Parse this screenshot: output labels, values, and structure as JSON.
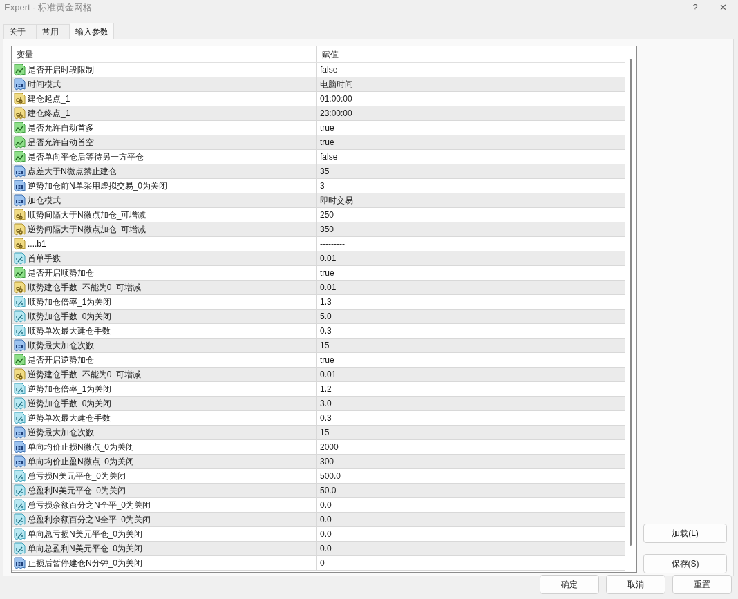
{
  "window": {
    "title": "Expert - 标准黄金网格",
    "help": "?",
    "close": "✕"
  },
  "tabs": [
    {
      "label": "关于",
      "selected": false
    },
    {
      "label": "常用",
      "selected": false
    },
    {
      "label": "输入参数",
      "selected": true
    }
  ],
  "table": {
    "columns": [
      "变量",
      "赋值"
    ],
    "rows": [
      {
        "kind": "bool",
        "name": "是否开启时段限制",
        "value": "false"
      },
      {
        "kind": "int",
        "name": "时间模式",
        "value": "电脑时间"
      },
      {
        "kind": "string",
        "name": "建仓起点_1",
        "value": "01:00:00"
      },
      {
        "kind": "string",
        "name": "建仓终点_1",
        "value": "23:00:00"
      },
      {
        "kind": "bool",
        "name": "是否允许自动首多",
        "value": "true"
      },
      {
        "kind": "bool",
        "name": "是否允许自动首空",
        "value": "true"
      },
      {
        "kind": "bool",
        "name": "是否单向平仓后等待另一方平仓",
        "value": "false"
      },
      {
        "kind": "int",
        "name": "点差大于N微点禁止建仓",
        "value": "35"
      },
      {
        "kind": "int",
        "name": "逆势加仓前N单采用虚拟交易_0为关闭",
        "value": "3"
      },
      {
        "kind": "int",
        "name": "加仓模式",
        "value": "即时交易"
      },
      {
        "kind": "string",
        "name": "顺势间隔大于N微点加仓_可增减",
        "value": "250"
      },
      {
        "kind": "string",
        "name": "逆势间隔大于N微点加仓_可增减",
        "value": "350"
      },
      {
        "kind": "string",
        "name": "....b1",
        "value": "---------"
      },
      {
        "kind": "double",
        "name": "首单手数",
        "value": "0.01"
      },
      {
        "kind": "bool",
        "name": "是否开启顺势加仓",
        "value": "true"
      },
      {
        "kind": "string",
        "name": "顺势建仓手数_不能为0_可增减",
        "value": "0.01"
      },
      {
        "kind": "double",
        "name": "顺势加仓倍率_1为关闭",
        "value": "1.3"
      },
      {
        "kind": "double",
        "name": "顺势加仓手数_0为关闭",
        "value": "5.0"
      },
      {
        "kind": "double",
        "name": "顺势单次最大建仓手数",
        "value": "0.3"
      },
      {
        "kind": "int",
        "name": "顺势最大加仓次数",
        "value": "15"
      },
      {
        "kind": "bool",
        "name": "是否开启逆势加仓",
        "value": "true"
      },
      {
        "kind": "string",
        "name": "逆势建仓手数_不能为0_可增减",
        "value": "0.01"
      },
      {
        "kind": "double",
        "name": "逆势加仓倍率_1为关闭",
        "value": "1.2"
      },
      {
        "kind": "double",
        "name": "逆势加仓手数_0为关闭",
        "value": "3.0"
      },
      {
        "kind": "double",
        "name": "逆势单次最大建仓手数",
        "value": "0.3"
      },
      {
        "kind": "int",
        "name": "逆势最大加仓次数",
        "value": "15"
      },
      {
        "kind": "int",
        "name": "单向均价止损N微点_0为关闭",
        "value": "2000"
      },
      {
        "kind": "int",
        "name": "单向均价止盈N微点_0为关闭",
        "value": "300"
      },
      {
        "kind": "double",
        "name": "总亏损N美元平仓_0为关闭",
        "value": "500.0"
      },
      {
        "kind": "double",
        "name": "总盈利N美元平仓_0为关闭",
        "value": "50.0"
      },
      {
        "kind": "double",
        "name": "总亏损余额百分之N全平_0为关闭",
        "value": "0.0"
      },
      {
        "kind": "double",
        "name": "总盈利余额百分之N全平_0为关闭",
        "value": "0.0"
      },
      {
        "kind": "double",
        "name": "单向总亏损N美元平仓_0为关闭",
        "value": "0.0"
      },
      {
        "kind": "double",
        "name": "单向总盈利N美元平仓_0为关闭",
        "value": "0.0"
      },
      {
        "kind": "int",
        "name": "止损后暂停建仓N分钟_0为关闭",
        "value": "0"
      }
    ]
  },
  "side_buttons": [
    "加载(L)",
    "保存(S)"
  ],
  "buttons": [
    "确定",
    "取消",
    "重置"
  ]
}
